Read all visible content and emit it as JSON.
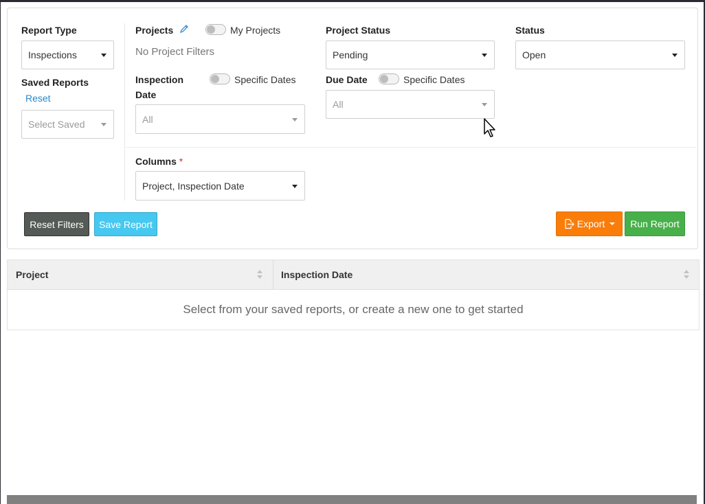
{
  "report_type": {
    "label": "Report Type",
    "value": "Inspections"
  },
  "saved_reports": {
    "label": "Saved Reports",
    "reset_link": "Reset",
    "placeholder": "Select Saved"
  },
  "projects": {
    "label": "Projects",
    "toggle_label": "My Projects",
    "empty_text": "No Project Filters"
  },
  "inspection_date": {
    "label_line1": "Inspection",
    "label_line2": "Date",
    "toggle_label": "Specific Dates",
    "value": "All"
  },
  "project_status": {
    "label": "Project Status",
    "value": "Pending"
  },
  "due_date": {
    "label": "Due Date",
    "toggle_label": "Specific Dates",
    "value": "All"
  },
  "status": {
    "label": "Status",
    "value": "Open"
  },
  "columns": {
    "label": "Columns",
    "required_mark": "*",
    "value": "Project, Inspection Date"
  },
  "buttons": {
    "reset_filters": "Reset Filters",
    "save_report": "Save Report",
    "export": "Export",
    "run_report": "Run Report"
  },
  "table": {
    "columns": [
      "Project",
      "Inspection Date"
    ],
    "empty_message": "Select from your saved reports, or create a new one to get started"
  },
  "colors": {
    "export": "#fa7d0a",
    "run": "#48b04a",
    "save": "#46c8f0",
    "reset": "#545a55",
    "link": "#2a86c8",
    "required": "#d9312b"
  },
  "icons": {
    "projects_edit": "pencil-icon",
    "export": "file-export-icon"
  }
}
